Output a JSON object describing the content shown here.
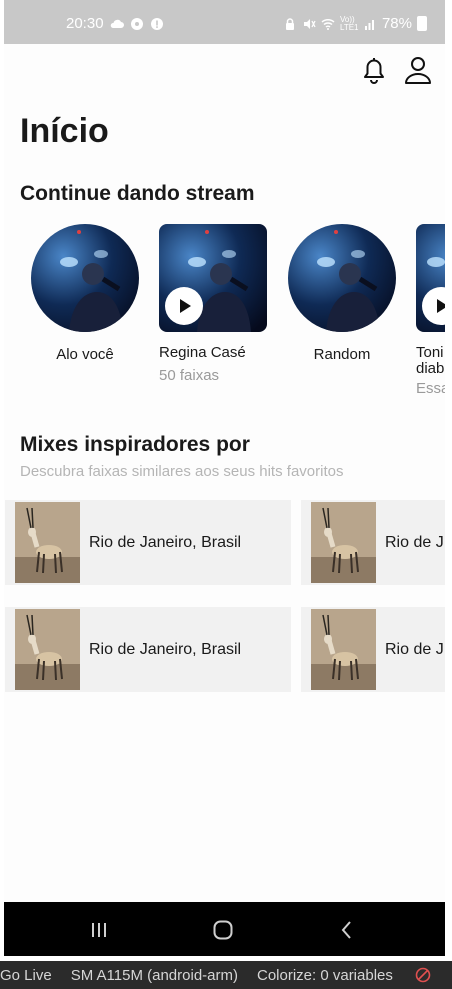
{
  "status_bar": {
    "time": "20:30",
    "battery": "78%",
    "network_label": "Vo)) LTE1"
  },
  "header": {
    "title": "Início",
    "icons": [
      "bell-icon",
      "user-icon"
    ]
  },
  "continue_section": {
    "title": "Continue dando stream",
    "items": [
      {
        "label": "Alo você",
        "sub": "",
        "shape": "round"
      },
      {
        "label": "Regina Casé",
        "sub": "50 faixas",
        "shape": "square"
      },
      {
        "label": "Random",
        "sub": "",
        "shape": "round"
      },
      {
        "label": "Toni",
        "label2": "diab",
        "sub": "Essa",
        "shape": "square"
      }
    ]
  },
  "mixes_section": {
    "title": "Mixes inspiradores por",
    "subtitle": "Descubra faixas similares aos seus hits favoritos",
    "cards": [
      {
        "label": "Rio de Janeiro, Brasil"
      },
      {
        "label": "Rio de J"
      },
      {
        "label": "Rio de Janeiro, Brasil"
      },
      {
        "label": "Rio de J"
      }
    ]
  },
  "nav_bar": {
    "buttons": [
      "recent-apps-icon",
      "home-icon",
      "back-icon"
    ]
  },
  "ide_strip": {
    "go_live": "Go Live",
    "device": "SM A115M (android-arm)",
    "colorize": "Colorize: 0 variables"
  },
  "colors": {
    "status_bar_bg": "#c8c8c8",
    "card_bg": "#f1f1f1",
    "subtitle_grey": "#b5b5b5",
    "nav_bg": "#000000",
    "ide_bg": "#2b2b2b"
  }
}
